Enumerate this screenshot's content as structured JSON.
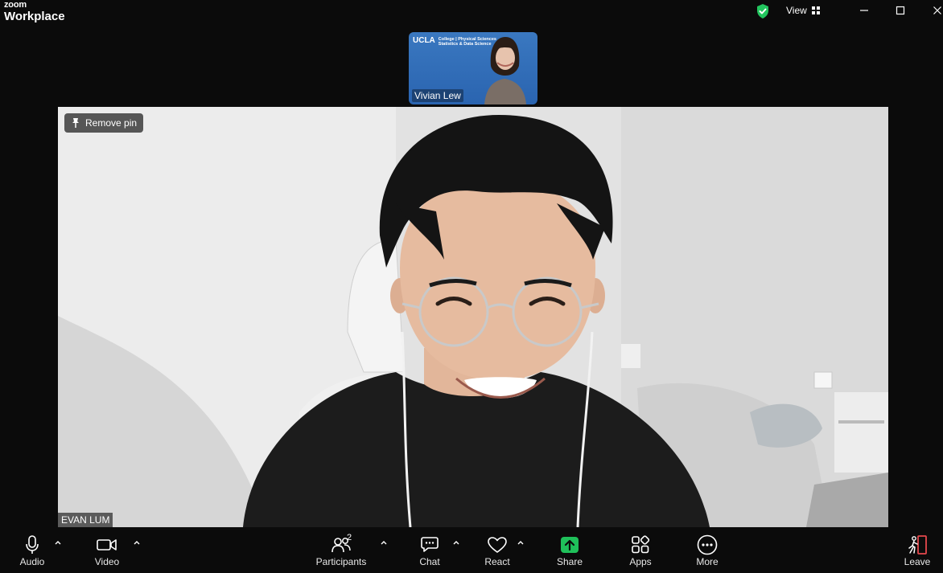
{
  "app": {
    "brand_small": "zoom",
    "brand_big": "Workplace",
    "view_label": "View"
  },
  "thumbnail": {
    "name": "Vivian Lew",
    "logo_text": "UCLA",
    "logo_sub": "College | Physical Sciences",
    "logo_sub2": "Statistics & Data Science"
  },
  "main": {
    "pin_label": "Remove pin",
    "name": "EVAN LUM"
  },
  "toolbar": {
    "audio": "Audio",
    "video": "Video",
    "participants": "Participants",
    "participants_count": "2",
    "chat": "Chat",
    "react": "React",
    "share": "Share",
    "apps": "Apps",
    "more": "More",
    "leave": "Leave"
  },
  "colors": {
    "shield": "#22c55e",
    "share": "#1fc05a",
    "leave": "#e5484d"
  }
}
